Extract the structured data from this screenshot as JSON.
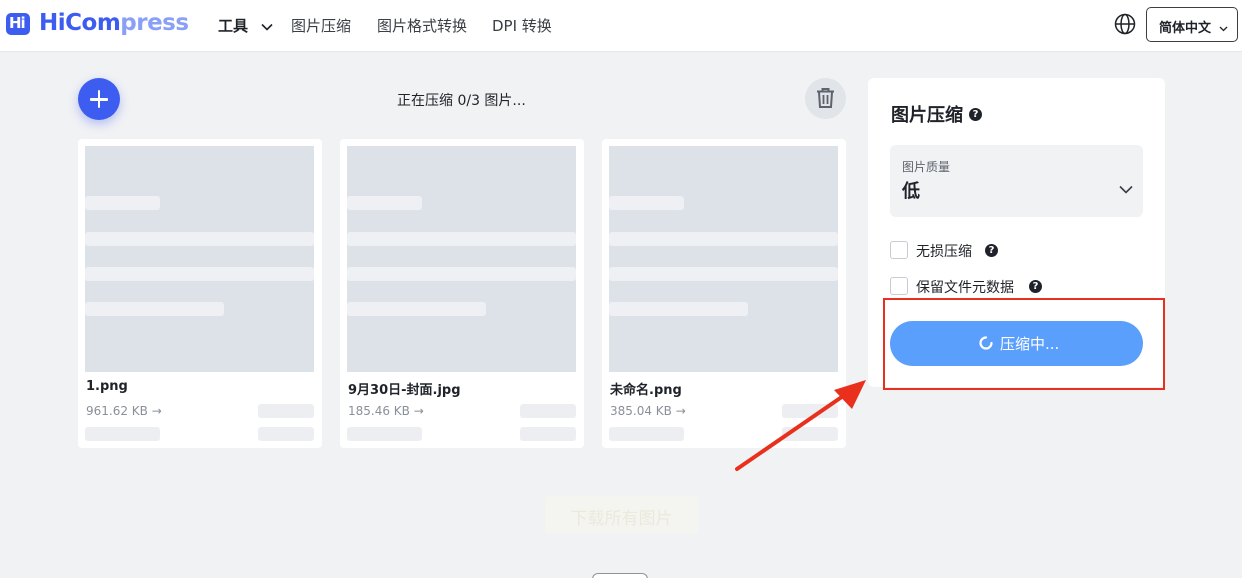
{
  "header": {
    "logo_mark": "Hi",
    "logo_text_strong": "HiCom",
    "logo_text_light": "press",
    "nav": {
      "tools": "工具",
      "compress": "图片压缩",
      "convert": "图片格式转换",
      "dpi": "DPI 转换"
    },
    "language": "简体中文"
  },
  "toolbar": {
    "status": "正在压缩 0/3 图片..."
  },
  "files": [
    {
      "name": "1.png",
      "size": "961.62 KB"
    },
    {
      "name": "9月30日-封面.jpg",
      "size": "185.46 KB"
    },
    {
      "name": "未命名.png",
      "size": "385.04 KB"
    }
  ],
  "arrow_glyph": "→",
  "panel": {
    "title": "图片压缩",
    "help_glyph": "?",
    "quality_label": "图片质量",
    "quality_value": "低",
    "lossless": "无损压缩",
    "keep_metadata": "保留文件元数据",
    "button": "压缩中..."
  },
  "bottom": {
    "faded_button": "下载所有图片"
  },
  "colors": {
    "brand": "#3d5cf0",
    "button": "#5b9ffd",
    "highlight": "#e8301c"
  }
}
